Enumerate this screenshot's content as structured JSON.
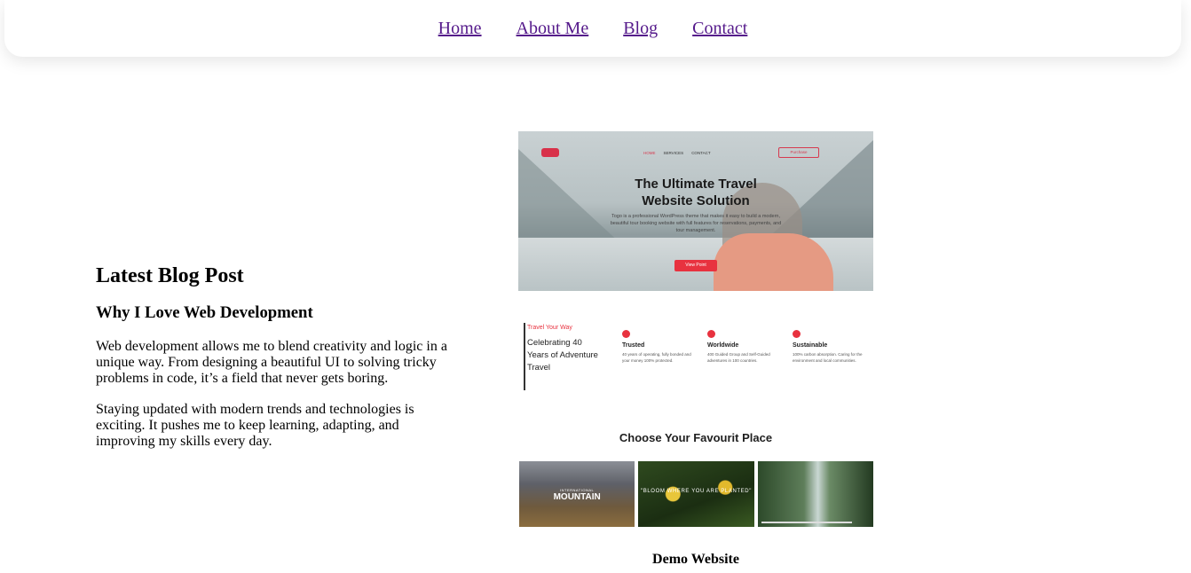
{
  "nav": {
    "items": [
      {
        "label": "Home"
      },
      {
        "label": "About Me"
      },
      {
        "label": "Blog"
      },
      {
        "label": "Contact"
      }
    ],
    "link_color": "#551a8b"
  },
  "post": {
    "section_title": "Latest Blog Post",
    "title": "Why I Love Web Development",
    "paragraphs": [
      "Web development allows me to blend creativity and logic in a unique way. From designing a beautiful UI to solving tricky problems in code, it’s a field that never gets boring.",
      "Staying updated with modern trends and technologies is exciting. It pushes me to keep learning, adapting, and improving my skills every day."
    ]
  },
  "preview": {
    "hero": {
      "menu": [
        "HOME",
        "SERVICES",
        "CONTACT"
      ],
      "purchase": "Purchase",
      "title_line1": "The Ultimate Travel",
      "title_line2": "Website Solution",
      "subtitle": "Togo is a professional WordPress theme that makes it easy to build a modern, beautiful tour booking website with full features for reservations, payments, and tour management.",
      "button": "View Point"
    },
    "features": {
      "kicker": "Travel Your Way",
      "headline": "Celebrating 40 Years of Adventure Travel",
      "items": [
        {
          "title": "Trusted",
          "desc": "40 years of operating, fully bonded and your money 100% protected."
        },
        {
          "title": "Worldwide",
          "desc": "400 Guided Group and Self-Guided adventures in 100 countries."
        },
        {
          "title": "Sustainable",
          "desc": "100% carbon absorption. Caring for the environment and local communities."
        }
      ]
    },
    "favourite_title": "Choose Your Favourit Place",
    "tiles": {
      "mountain_small": "INTERNATIONAL",
      "mountain": "MOUNTAIN",
      "bloom": "\"BLOOM WHERE YOU ARE PLANTED\""
    },
    "accent_color": "#e8323f"
  },
  "demo_caption": "Demo Website"
}
